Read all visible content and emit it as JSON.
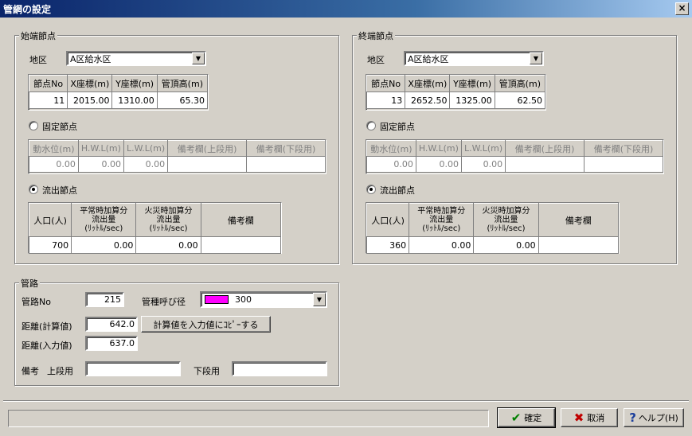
{
  "window": {
    "title": "管網の設定",
    "close": "×"
  },
  "start_node": {
    "group_label": "始端節点",
    "district_label": "地区",
    "district": "A区給水区",
    "coord_headers": [
      "節点No",
      "X座標(m)",
      "Y座標(m)",
      "管頂高(m)"
    ],
    "coord_values": [
      "11",
      "2015.00",
      "1310.00",
      "65.30"
    ],
    "fixed_label": "固定節点",
    "fixed_headers": [
      "動水位(m)",
      "H.W.L(m)",
      "L.W.L(m)",
      "備考欄(上段用)",
      "備考欄(下段用)"
    ],
    "fixed_values": [
      "0.00",
      "0.00",
      "0.00",
      "",
      ""
    ],
    "outflow_label": "流出節点",
    "outflow_headers": [
      "人口(人)",
      "平常時加算分\n流出量\n(ﾘｯﾄﾙ/sec)",
      "火災時加算分\n流出量\n(ﾘｯﾄﾙ/sec)",
      "備考欄"
    ],
    "outflow_values": [
      "700",
      "0.00",
      "0.00",
      ""
    ]
  },
  "end_node": {
    "group_label": "終端節点",
    "district_label": "地区",
    "district": "A区給水区",
    "coord_headers": [
      "節点No",
      "X座標(m)",
      "Y座標(m)",
      "管頂高(m)"
    ],
    "coord_values": [
      "13",
      "2652.50",
      "1325.00",
      "62.50"
    ],
    "fixed_label": "固定節点",
    "fixed_headers": [
      "動水位(m)",
      "H.W.L(m)",
      "L.W.L(m)",
      "備考欄(上段用)",
      "備考欄(下段用)"
    ],
    "fixed_values": [
      "0.00",
      "0.00",
      "0.00",
      "",
      ""
    ],
    "outflow_label": "流出節点",
    "outflow_headers": [
      "人口(人)",
      "平常時加算分\n流出量\n(ﾘｯﾄﾙ/sec)",
      "火災時加算分\n流出量\n(ﾘｯﾄﾙ/sec)",
      "備考欄"
    ],
    "outflow_values": [
      "360",
      "0.00",
      "0.00",
      ""
    ]
  },
  "pipe": {
    "group_label": "管路",
    "pipe_no_label": "管路No",
    "pipe_no": "215",
    "type_label": "管種呼び径",
    "type_value": "300",
    "type_color": "#ff00ff",
    "calc_label": "距離(計算値)",
    "calc_value": "642.0",
    "copy_button": "計算値を入力値にｺﾋﾟｰする",
    "input_label": "距離(入力値)",
    "input_value": "637.0",
    "note_label": "備考",
    "upper_label": "上段用",
    "upper_value": "",
    "lower_label": "下段用",
    "lower_value": ""
  },
  "footer": {
    "ok": "確定",
    "cancel": "取消",
    "help": "ヘルプ(H)"
  }
}
